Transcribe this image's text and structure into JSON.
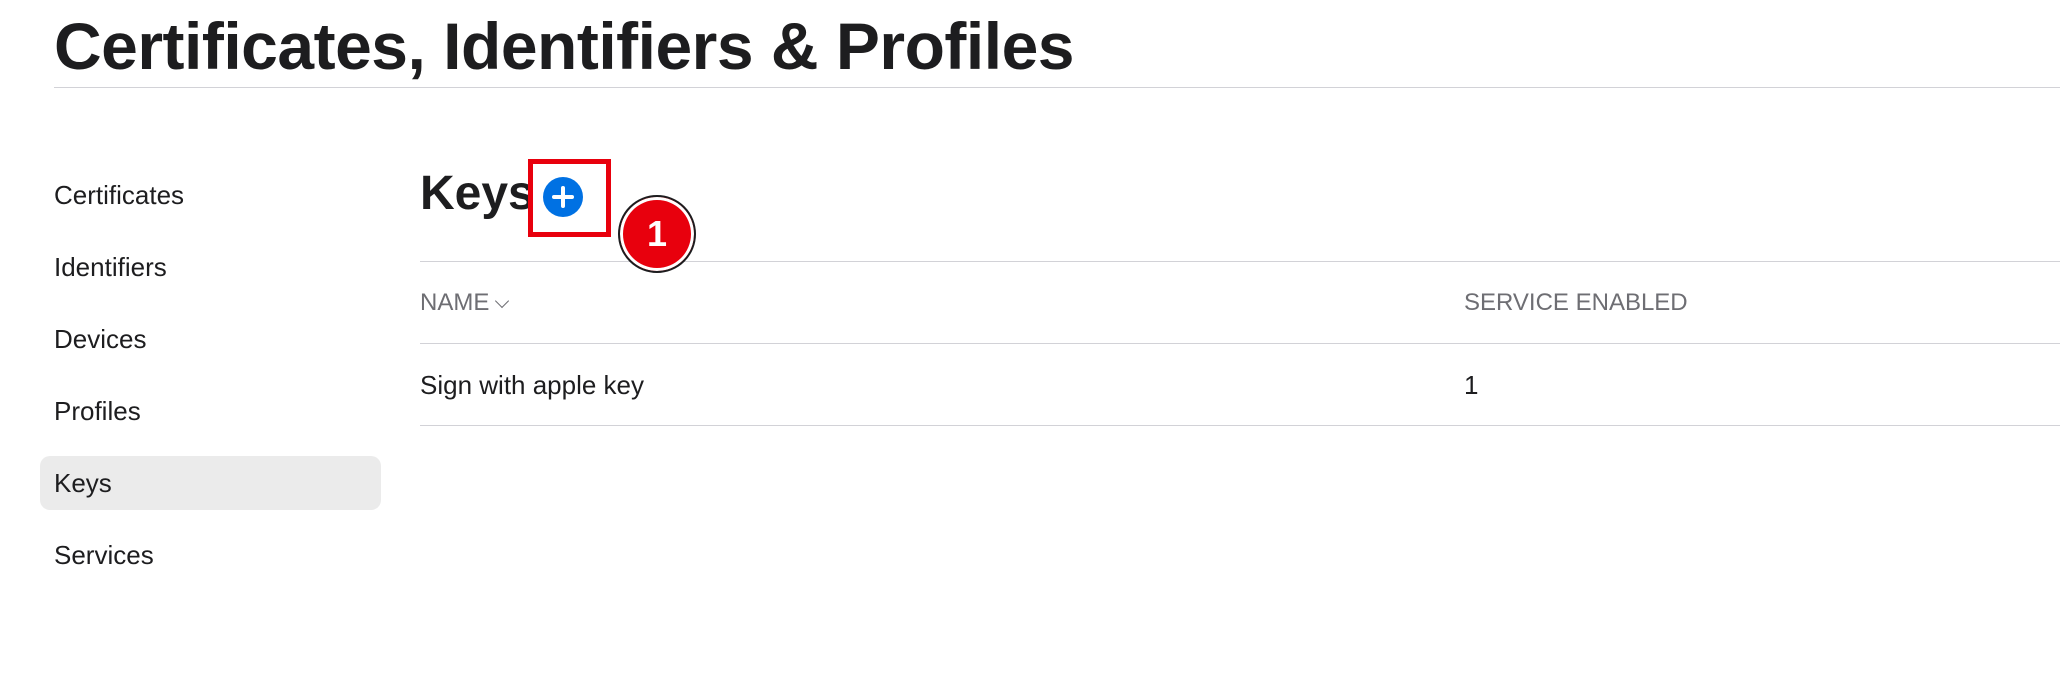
{
  "header": {
    "title": "Certificates, Identifiers & Profiles"
  },
  "sidebar": {
    "items": [
      {
        "label": "Certificates"
      },
      {
        "label": "Identifiers"
      },
      {
        "label": "Devices"
      },
      {
        "label": "Profiles"
      },
      {
        "label": "Keys",
        "active": true
      },
      {
        "label": "Services"
      }
    ]
  },
  "main": {
    "title": "Keys",
    "add_icon": "plus-circle-icon",
    "annotation": {
      "step": "1",
      "color": "#e8000d"
    },
    "table": {
      "columns": [
        {
          "label": "NAME",
          "sort_icon": "chevron-down-icon"
        },
        {
          "label": "SERVICE ENABLED"
        }
      ],
      "rows": [
        {
          "name": "Sign with apple key",
          "service_enabled": "1"
        }
      ]
    }
  },
  "colors": {
    "accent": "#0071e3",
    "active_item_bg": "#ebebeb",
    "divider": "#d2d2d7",
    "annotation_red": "#e8000d"
  }
}
